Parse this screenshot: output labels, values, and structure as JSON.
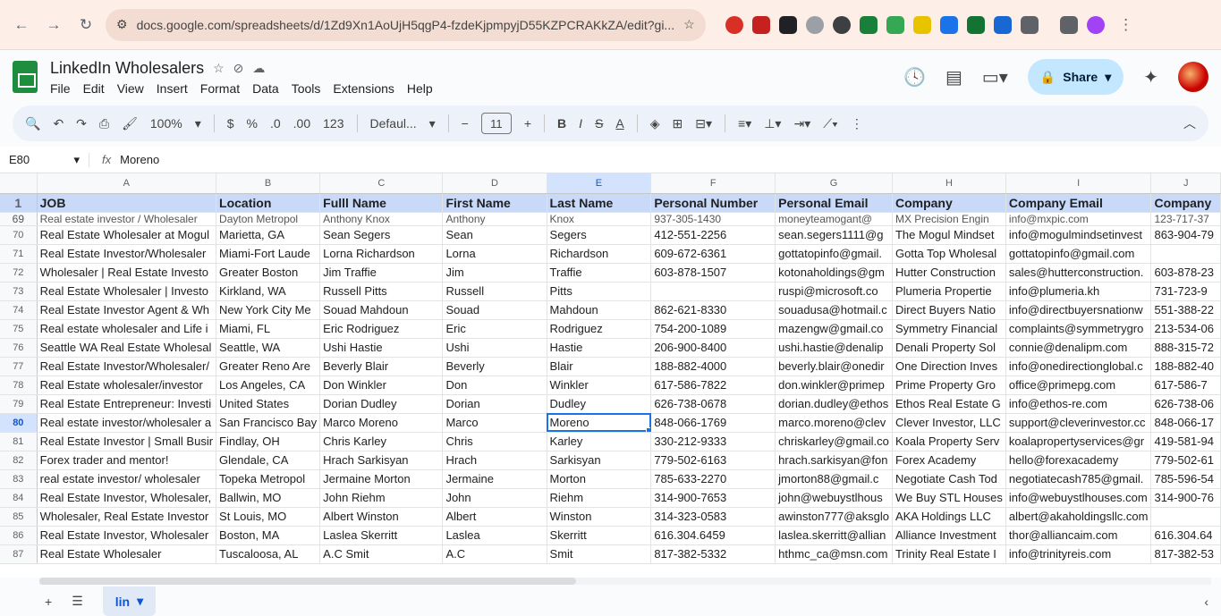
{
  "browser": {
    "url": "docs.google.com/spreadsheets/d/1Zd9Xn1AoUjH5qgP4-fzdeKjpmpyjD55KZPCRAKkZA/edit?gi..."
  },
  "app": {
    "title": "LinkedIn Wholesalers",
    "menu": [
      "File",
      "Edit",
      "View",
      "Insert",
      "Format",
      "Data",
      "Tools",
      "Extensions",
      "Help"
    ],
    "share_label": "Share"
  },
  "toolbar": {
    "zoom": "100%",
    "currency": "$",
    "percent": "%",
    "decimal_dec": ".0",
    "decimal_inc": ".00",
    "number_format": "123",
    "font": "Defaul...",
    "font_size": "11",
    "minus": "−",
    "plus": "+",
    "bold": "B",
    "italic": "I",
    "strike": "S",
    "text_color": "A"
  },
  "formula_bar": {
    "cell_ref": "E80",
    "fx": "fx",
    "value": "Moreno"
  },
  "columns": [
    "A",
    "B",
    "C",
    "D",
    "E",
    "F",
    "G",
    "H",
    "I",
    "J"
  ],
  "selected_column": "E",
  "header_row": {
    "num": "1",
    "cells": [
      "JOB",
      "Location",
      "Fulll Name",
      "First Name",
      "Last Name",
      "Personal Number",
      "Personal Email",
      "Company",
      "Company Email",
      "Company"
    ]
  },
  "partial_row": {
    "num": "69",
    "cells": [
      "Real estate investor / Wholesaler",
      "Dayton Metropol",
      "Anthony Knox",
      "Anthony",
      "Knox",
      "937-305-1430",
      "moneyteamogant@",
      "MX Precision Engin",
      "info@mxpic.com",
      "123-717-37"
    ]
  },
  "rows": [
    {
      "num": "70",
      "cells": [
        "Real Estate Wholesaler at Mogul",
        "Marietta, GA",
        "Sean Segers",
        "Sean",
        "Segers",
        "412-551-2256",
        "sean.segers1111@g",
        "The Mogul Mindset",
        "info@mogulmindsetinvest",
        "863-904-79"
      ]
    },
    {
      "num": "71",
      "cells": [
        "Real Estate Investor/Wholesaler",
        "Miami-Fort Laude",
        "Lorna Richardson",
        "Lorna",
        "Richardson",
        "609-672-6361",
        "gottatopinfo@gmail.",
        "Gotta Top Wholesal",
        "gottatopinfo@gmail.com",
        ""
      ]
    },
    {
      "num": "72",
      "cells": [
        "Wholesaler | Real Estate Investo",
        "Greater Boston",
        "Jim Traffie",
        "Jim",
        "Traffie",
        "603-878-1507",
        "kotonaholdings@gm",
        "Hutter Construction",
        "sales@hutterconstruction.",
        "603-878-23"
      ]
    },
    {
      "num": "73",
      "cells": [
        "Real Estate Wholesaler | Investo",
        "Kirkland, WA",
        "Russell Pitts",
        "Russell",
        "Pitts",
        "",
        "ruspi@microsoft.co",
        "Plumeria Propertie",
        "info@plumeria.kh",
        "731-723-9"
      ]
    },
    {
      "num": "74",
      "cells": [
        "Real Estate Investor Agent & Wh",
        "New York City Me",
        "Souad Mahdoun",
        "Souad",
        "Mahdoun",
        "862-621-8330",
        "souadusa@hotmail.c",
        "Direct Buyers Natio",
        "info@directbuyersnationw",
        "551-388-22"
      ]
    },
    {
      "num": "75",
      "cells": [
        "Real estate wholesaler and Life i",
        "Miami, FL",
        "Eric Rodriguez",
        "Eric",
        "Rodriguez",
        "754-200-1089",
        "mazengw@gmail.co",
        "Symmetry Financial",
        "complaints@symmetrygro",
        "213-534-06"
      ]
    },
    {
      "num": "76",
      "cells": [
        "Seattle WA Real Estate Wholesal",
        "Seattle, WA",
        "Ushi Hastie",
        "Ushi",
        "Hastie",
        "206-900-8400",
        "ushi.hastie@denalip",
        "Denali Property Sol",
        "connie@denalipm.com",
        "888-315-72"
      ]
    },
    {
      "num": "77",
      "cells": [
        "Real Estate Investor/Wholesaler/",
        "Greater Reno Are",
        "Beverly Blair",
        "Beverly",
        "Blair",
        "188-882-4000",
        "beverly.blair@onedir",
        "One Direction Inves",
        "info@onedirectionglobal.c",
        "188-882-40"
      ]
    },
    {
      "num": "78",
      "cells": [
        "Real Estate wholesaler/investor",
        "Los Angeles, CA",
        "Don Winkler",
        "Don",
        "Winkler",
        "617-586-7822",
        "don.winkler@primep",
        "Prime Property Gro",
        "office@primepg.com",
        "617-586-7"
      ]
    },
    {
      "num": "79",
      "cells": [
        "Real Estate Entrepreneur: Investi",
        "United States",
        "Dorian Dudley",
        "Dorian",
        "Dudley",
        "626-738-0678",
        "dorian.dudley@ethos",
        "Ethos Real Estate G",
        "info@ethos-re.com",
        "626-738-06"
      ]
    },
    {
      "num": "80",
      "cells": [
        "Real estate investor/wholesaler a",
        "San Francisco Bay",
        "Marco Moreno",
        "Marco",
        "Moreno",
        "848-066-1769",
        "marco.moreno@clev",
        "Clever Investor, LLC",
        "support@cleverinvestor.cc",
        "848-066-17"
      ]
    },
    {
      "num": "81",
      "cells": [
        "Real Estate Investor | Small Busir",
        "Findlay, OH",
        "Chris Karley",
        "Chris",
        "Karley",
        "330-212-9333",
        "chriskarley@gmail.co",
        "Koala Property Serv",
        "koalapropertyservices@gr",
        "419-581-94"
      ]
    },
    {
      "num": "82",
      "cells": [
        "Forex trader and mentor!",
        "Glendale, CA",
        "Hrach Sarkisyan",
        "Hrach",
        "Sarkisyan",
        "779-502-6163",
        "hrach.sarkisyan@fon",
        "Forex Academy",
        "hello@forexacademy",
        "779-502-61"
      ]
    },
    {
      "num": "83",
      "cells": [
        "real estate investor/ wholesaler",
        "Topeka Metropol",
        "Jermaine Morton",
        "Jermaine",
        "Morton",
        "785-633-2270",
        "jmorton88@gmail.c",
        "Negotiate Cash Tod",
        "negotiatecash785@gmail.",
        "785-596-54"
      ]
    },
    {
      "num": "84",
      "cells": [
        "Real Estate Investor, Wholesaler,",
        "Ballwin, MO",
        "John Riehm",
        "John",
        "Riehm",
        "314-900-7653",
        "john@webuystlhous",
        "We Buy STL Houses",
        "info@webuystlhouses.com",
        "314-900-76"
      ]
    },
    {
      "num": "85",
      "cells": [
        "Wholesaler, Real Estate Investor",
        "St Louis, MO",
        "Albert Winston",
        "Albert",
        "Winston",
        "314-323-0583",
        "awinston777@aksglo",
        "AKA Holdings LLC",
        "albert@akaholdingsllc.com",
        ""
      ]
    },
    {
      "num": "86",
      "cells": [
        "Real Estate Investor, Wholesaler",
        "Boston, MA",
        "Laslea Skerritt",
        "Laslea",
        "Skerritt",
        "616.304.6459",
        "laslea.skerritt@allian",
        "Alliance Investment",
        "thor@alliancaim.com",
        "616.304.64"
      ]
    },
    {
      "num": "87",
      "cells": [
        "Real Estate Wholesaler",
        "Tuscaloosa, AL",
        "A.C Smit",
        "A.C",
        "Smit",
        "817-382-5332",
        "hthmc_ca@msn.com",
        "Trinity Real Estate I",
        "info@trinityreis.com",
        "817-382-53"
      ]
    }
  ],
  "selected": {
    "row": "80",
    "col": 4
  },
  "sheet_tabs": {
    "active": "lin"
  }
}
